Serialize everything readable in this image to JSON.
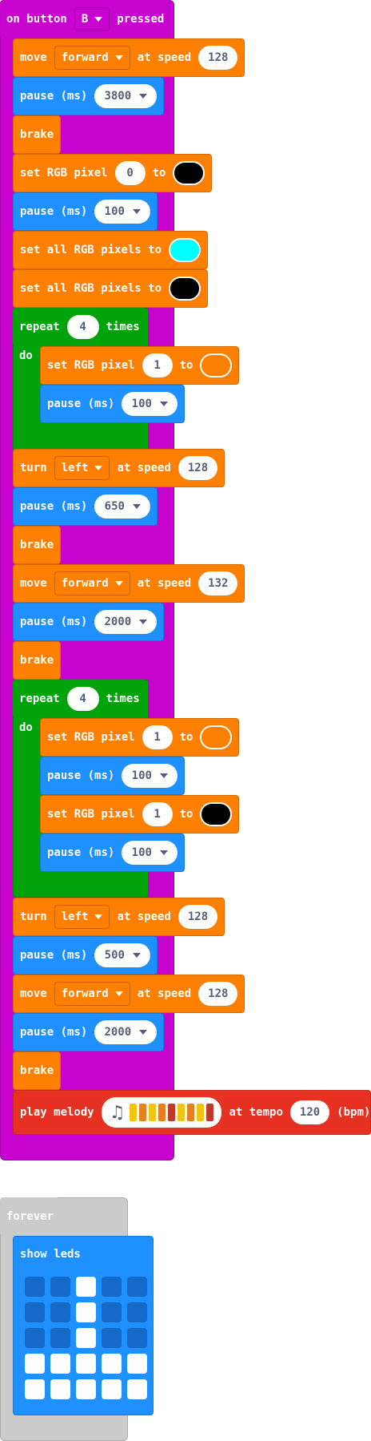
{
  "event": {
    "prefix": "on button",
    "button": "B",
    "suffix": "pressed"
  },
  "blocks": {
    "b1": {
      "label": "move",
      "dir": "forward",
      "mid": "at speed",
      "speed": "128"
    },
    "b2": {
      "label": "pause (ms)",
      "value": "3800"
    },
    "b3": {
      "label": "brake"
    },
    "b4": {
      "label": "set RGB pixel",
      "index": "0",
      "to": "to",
      "color": "#000000"
    },
    "b5": {
      "label": "pause (ms)",
      "value": "100"
    },
    "b6": {
      "label": "set all RGB pixels to",
      "color": "#00ffff"
    },
    "b7": {
      "label": "set all RGB pixels to",
      "color": "#000000"
    },
    "r1": {
      "label": "repeat",
      "count": "4",
      "suffix": "times",
      "do": "do"
    },
    "r1a": {
      "label": "set RGB pixel",
      "index": "1",
      "to": "to",
      "color": "#ff8000"
    },
    "r1b": {
      "label": "pause (ms)",
      "value": "100"
    },
    "b8": {
      "label": "turn",
      "dir": "left",
      "mid": "at speed",
      "speed": "128"
    },
    "b9": {
      "label": "pause (ms)",
      "value": "650"
    },
    "b10": {
      "label": "brake"
    },
    "b11": {
      "label": "move",
      "dir": "forward",
      "mid": "at speed",
      "speed": "132"
    },
    "b12": {
      "label": "pause (ms)",
      "value": "2000"
    },
    "b13": {
      "label": "brake"
    },
    "r2": {
      "label": "repeat",
      "count": "4",
      "suffix": "times",
      "do": "do"
    },
    "r2a": {
      "label": "set RGB pixel",
      "index": "1",
      "to": "to",
      "color": "#ff8000"
    },
    "r2b": {
      "label": "pause (ms)",
      "value": "100"
    },
    "r2c": {
      "label": "set RGB pixel",
      "index": "1",
      "to": "to",
      "color": "#000000"
    },
    "r2d": {
      "label": "pause (ms)",
      "value": "100"
    },
    "b14": {
      "label": "turn",
      "dir": "left",
      "mid": "at speed",
      "speed": "128"
    },
    "b15": {
      "label": "pause (ms)",
      "value": "500"
    },
    "b16": {
      "label": "move",
      "dir": "forward",
      "mid": "at speed",
      "speed": "128"
    },
    "b17": {
      "label": "pause (ms)",
      "value": "2000"
    },
    "b18": {
      "label": "brake"
    },
    "b19": {
      "label": "play melody",
      "mid": "at tempo",
      "tempo": "120",
      "suffix": "(bpm)",
      "notes": [
        "#f1c40f",
        "#e67e22",
        "#f1c40f",
        "#e67e22",
        "#c0392b",
        "#f1c40f",
        "#e67e22",
        "#f1c40f",
        "#c0392b"
      ]
    }
  },
  "forever": {
    "label": "forever",
    "leds_label": "show leds",
    "leds": [
      [
        0,
        0,
        1,
        0,
        0
      ],
      [
        0,
        0,
        1,
        0,
        0
      ],
      [
        0,
        0,
        1,
        0,
        0
      ],
      [
        1,
        1,
        1,
        1,
        1
      ],
      [
        1,
        1,
        1,
        1,
        1
      ]
    ]
  }
}
